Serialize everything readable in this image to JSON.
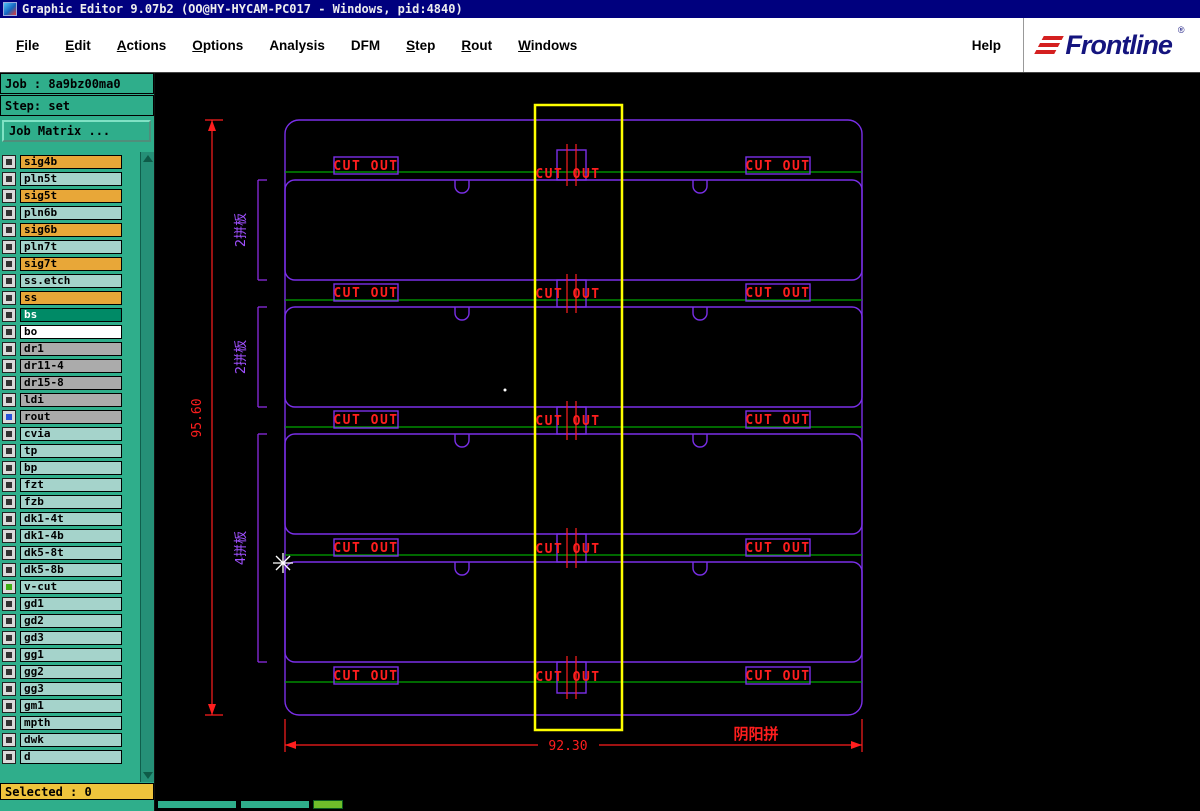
{
  "title_bar": {
    "title": "Graphic Editor 9.07b2 (OO@HY-HYCAM-PC017 - Windows, pid:4840)"
  },
  "menu": {
    "items": [
      {
        "ul": "F",
        "rest": "ile"
      },
      {
        "ul": "E",
        "rest": "dit"
      },
      {
        "ul": "A",
        "rest": "ctions"
      },
      {
        "ul": "O",
        "rest": "ptions"
      },
      {
        "ul": "",
        "rest": "Analysis"
      },
      {
        "ul": "",
        "rest": "DFM"
      },
      {
        "ul": "S",
        "rest": "tep"
      },
      {
        "ul": "R",
        "rest": "out"
      },
      {
        "ul": "W",
        "rest": "indows"
      }
    ],
    "help_label": "Help",
    "logo_text": "Frontline",
    "logo_reg": "®"
  },
  "sidebar": {
    "job_label": "Job : 8a9bz00ma0",
    "step_label": "Step: set",
    "matrix_button": "Job Matrix ...",
    "selected_label": "Selected : 0",
    "layers": [
      {
        "name": "sig4b",
        "bg": "#E8A738",
        "fg": "#000000",
        "check": "#333333"
      },
      {
        "name": "pln5t",
        "bg": "#A5D3CB",
        "fg": "#000000",
        "check": "#333333"
      },
      {
        "name": "sig5t",
        "bg": "#E8A738",
        "fg": "#000000",
        "check": "#333333"
      },
      {
        "name": "pln6b",
        "bg": "#A5D3CB",
        "fg": "#000000",
        "check": "#333333"
      },
      {
        "name": "sig6b",
        "bg": "#E8A738",
        "fg": "#000000",
        "check": "#333333"
      },
      {
        "name": "pln7t",
        "bg": "#A5D3CB",
        "fg": "#000000",
        "check": "#333333"
      },
      {
        "name": "sig7t",
        "bg": "#E8A738",
        "fg": "#000000",
        "check": "#333333"
      },
      {
        "name": "ss.etch",
        "bg": "#A5D3CB",
        "fg": "#000000",
        "check": "#333333"
      },
      {
        "name": "ss",
        "bg": "#E8A738",
        "fg": "#000000",
        "check": "#333333"
      },
      {
        "name": "bs",
        "bg": "#008A66",
        "fg": "#FFFFFF",
        "check": "#333333"
      },
      {
        "name": "bo",
        "bg": "#FFFFFF",
        "fg": "#000000",
        "check": "#333333"
      },
      {
        "name": "dr1",
        "bg": "#ABABAB",
        "fg": "#000000",
        "check": "#333333"
      },
      {
        "name": "dr11-4",
        "bg": "#ABABAB",
        "fg": "#000000",
        "check": "#333333"
      },
      {
        "name": "dr15-8",
        "bg": "#ABABAB",
        "fg": "#000000",
        "check": "#333333"
      },
      {
        "name": "ldi",
        "bg": "#ABABAB",
        "fg": "#000000",
        "check": "#333333"
      },
      {
        "name": "rout",
        "bg": "#ABABAB",
        "fg": "#000000",
        "check": "#2653D9"
      },
      {
        "name": "cvia",
        "bg": "#A5D3CB",
        "fg": "#000000",
        "check": "#333333"
      },
      {
        "name": "tp",
        "bg": "#A5D3CB",
        "fg": "#000000",
        "check": "#333333"
      },
      {
        "name": "bp",
        "bg": "#A5D3CB",
        "fg": "#000000",
        "check": "#333333"
      },
      {
        "name": "fzt",
        "bg": "#A5D3CB",
        "fg": "#000000",
        "check": "#333333"
      },
      {
        "name": "fzb",
        "bg": "#A5D3CB",
        "fg": "#000000",
        "check": "#333333"
      },
      {
        "name": "dk1-4t",
        "bg": "#A5D3CB",
        "fg": "#000000",
        "check": "#333333"
      },
      {
        "name": "dk1-4b",
        "bg": "#A5D3CB",
        "fg": "#000000",
        "check": "#333333"
      },
      {
        "name": "dk5-8t",
        "bg": "#A5D3CB",
        "fg": "#000000",
        "check": "#333333"
      },
      {
        "name": "dk5-8b",
        "bg": "#A5D3CB",
        "fg": "#000000",
        "check": "#333333"
      },
      {
        "name": "v-cut",
        "bg": "#A5D3CB",
        "fg": "#000000",
        "check": "#3FAE12"
      },
      {
        "name": "gd1",
        "bg": "#A5D3CB",
        "fg": "#000000",
        "check": "#333333"
      },
      {
        "name": "gd2",
        "bg": "#A5D3CB",
        "fg": "#000000",
        "check": "#333333"
      },
      {
        "name": "gd3",
        "bg": "#A5D3CB",
        "fg": "#000000",
        "check": "#333333"
      },
      {
        "name": "gg1",
        "bg": "#A5D3CB",
        "fg": "#000000",
        "check": "#333333"
      },
      {
        "name": "gg2",
        "bg": "#A5D3CB",
        "fg": "#000000",
        "check": "#333333"
      },
      {
        "name": "gg3",
        "bg": "#A5D3CB",
        "fg": "#000000",
        "check": "#333333"
      },
      {
        "name": "gm1",
        "bg": "#A5D3CB",
        "fg": "#000000",
        "check": "#333333"
      },
      {
        "name": "mpth",
        "bg": "#A5D3CB",
        "fg": "#000000",
        "check": "#333333"
      },
      {
        "name": "dwk",
        "bg": "#A5D3CB",
        "fg": "#000000",
        "check": "#333333"
      },
      {
        "name": "d",
        "bg": "#A5D3CB",
        "fg": "#000000",
        "check": "#333333"
      }
    ]
  },
  "canvas": {
    "cut_out": "CUT OUT",
    "dim_height": "95.60",
    "dim_width": "92.30",
    "row_labels": [
      "2拼板",
      "2拼板",
      "4拼板"
    ],
    "note": "阴阳拼",
    "colors": {
      "panel_outline": "#7A2FE8",
      "cut_text": "#FF1E1E",
      "separator_line": "#00A800",
      "highlight": "#FFFF00",
      "dimension": "#FF1E1E",
      "sidebar": "#2FAE8B",
      "selected_bar": "#EFC43C"
    }
  }
}
